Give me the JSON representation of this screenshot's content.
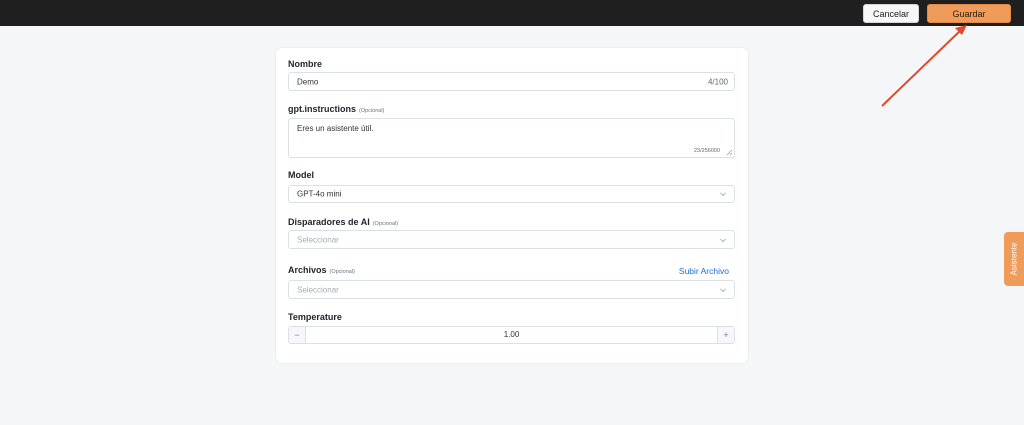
{
  "header": {
    "cancel_label": "Cancelar",
    "save_label": "Guardar"
  },
  "form": {
    "name": {
      "label": "Nombre",
      "value": "Demo",
      "counter": "4/100"
    },
    "instructions": {
      "label": "gpt.instructions",
      "optional": "(Opcional)",
      "value": "Eres un asistente útil.",
      "counter": "23/256000"
    },
    "model": {
      "label": "Model",
      "value": "GPT-4o mini"
    },
    "triggers": {
      "label": "Disparadores de AI",
      "optional": "(Opcional)",
      "placeholder": "Seleccionar"
    },
    "files": {
      "label": "Archivos",
      "optional": "(Opcional)",
      "upload_label": "Subir Archivo",
      "placeholder": "Seleccionar"
    },
    "temperature": {
      "label": "Temperature",
      "value": "1.00",
      "minus": "−",
      "plus": "+"
    }
  },
  "assistant_tab": {
    "label": "Asistente"
  },
  "icons": {
    "chevron": "chevron-down-icon",
    "resize": "resize-handle-icon"
  },
  "colors": {
    "accent": "#ef9c5a",
    "link": "#1a6fd8",
    "annotation_arrow": "#e04a2b"
  }
}
